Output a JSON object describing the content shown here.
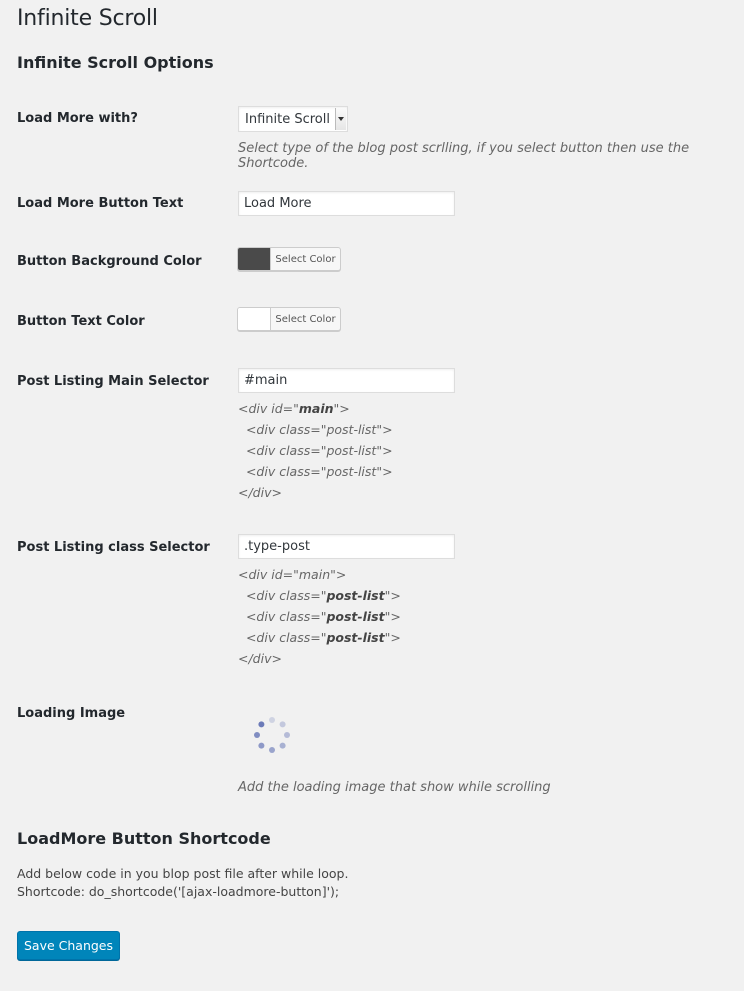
{
  "page": {
    "title": "Infinite Scroll"
  },
  "options": {
    "heading": "Infinite Scroll Options",
    "load_more_with": {
      "label": "Load More with?",
      "selected": "Infinite Scroll",
      "description": "Select type of the blog post scrlling, if you select button then use the Shortcode."
    },
    "button_text": {
      "label": "Load More Button Text",
      "value": "Load More"
    },
    "button_bg_color": {
      "label": "Button Background Color",
      "button_label": "Select Color",
      "color": "#4a4a4a"
    },
    "button_text_color": {
      "label": "Button Text Color",
      "button_label": "Select Color",
      "color": "#ffffff"
    },
    "main_selector": {
      "label": "Post Listing Main Selector",
      "value": "#main",
      "example": {
        "line1_pre": "<div id=\"",
        "line1_bold": "main",
        "line1_post": "\">",
        "line2": "  <div class=\"post-list\">",
        "line3": "  <div class=\"post-list\">",
        "line4": "  <div class=\"post-list\">",
        "line5": "</div>"
      }
    },
    "class_selector": {
      "label": "Post Listing class Selector",
      "value": ".type-post",
      "example": {
        "line1": "<div id=\"main\">",
        "line_pre": "  <div class=\"",
        "line_bold": "post-list",
        "line_post": "\">",
        "line5": "</div>"
      }
    },
    "loading_image": {
      "label": "Loading Image",
      "icon": "spinner-icon",
      "description": "Add the loading image that show while scrolling"
    }
  },
  "shortcode": {
    "heading": "LoadMore Button Shortcode",
    "line1": "Add below code in you blop post file after while loop.",
    "line2": "Shortcode: do_shortcode('[ajax-loadmore-button]');"
  },
  "actions": {
    "save_label": "Save Changes"
  },
  "colors": {
    "accent": "#0085ba",
    "background": "#f1f1f1"
  }
}
